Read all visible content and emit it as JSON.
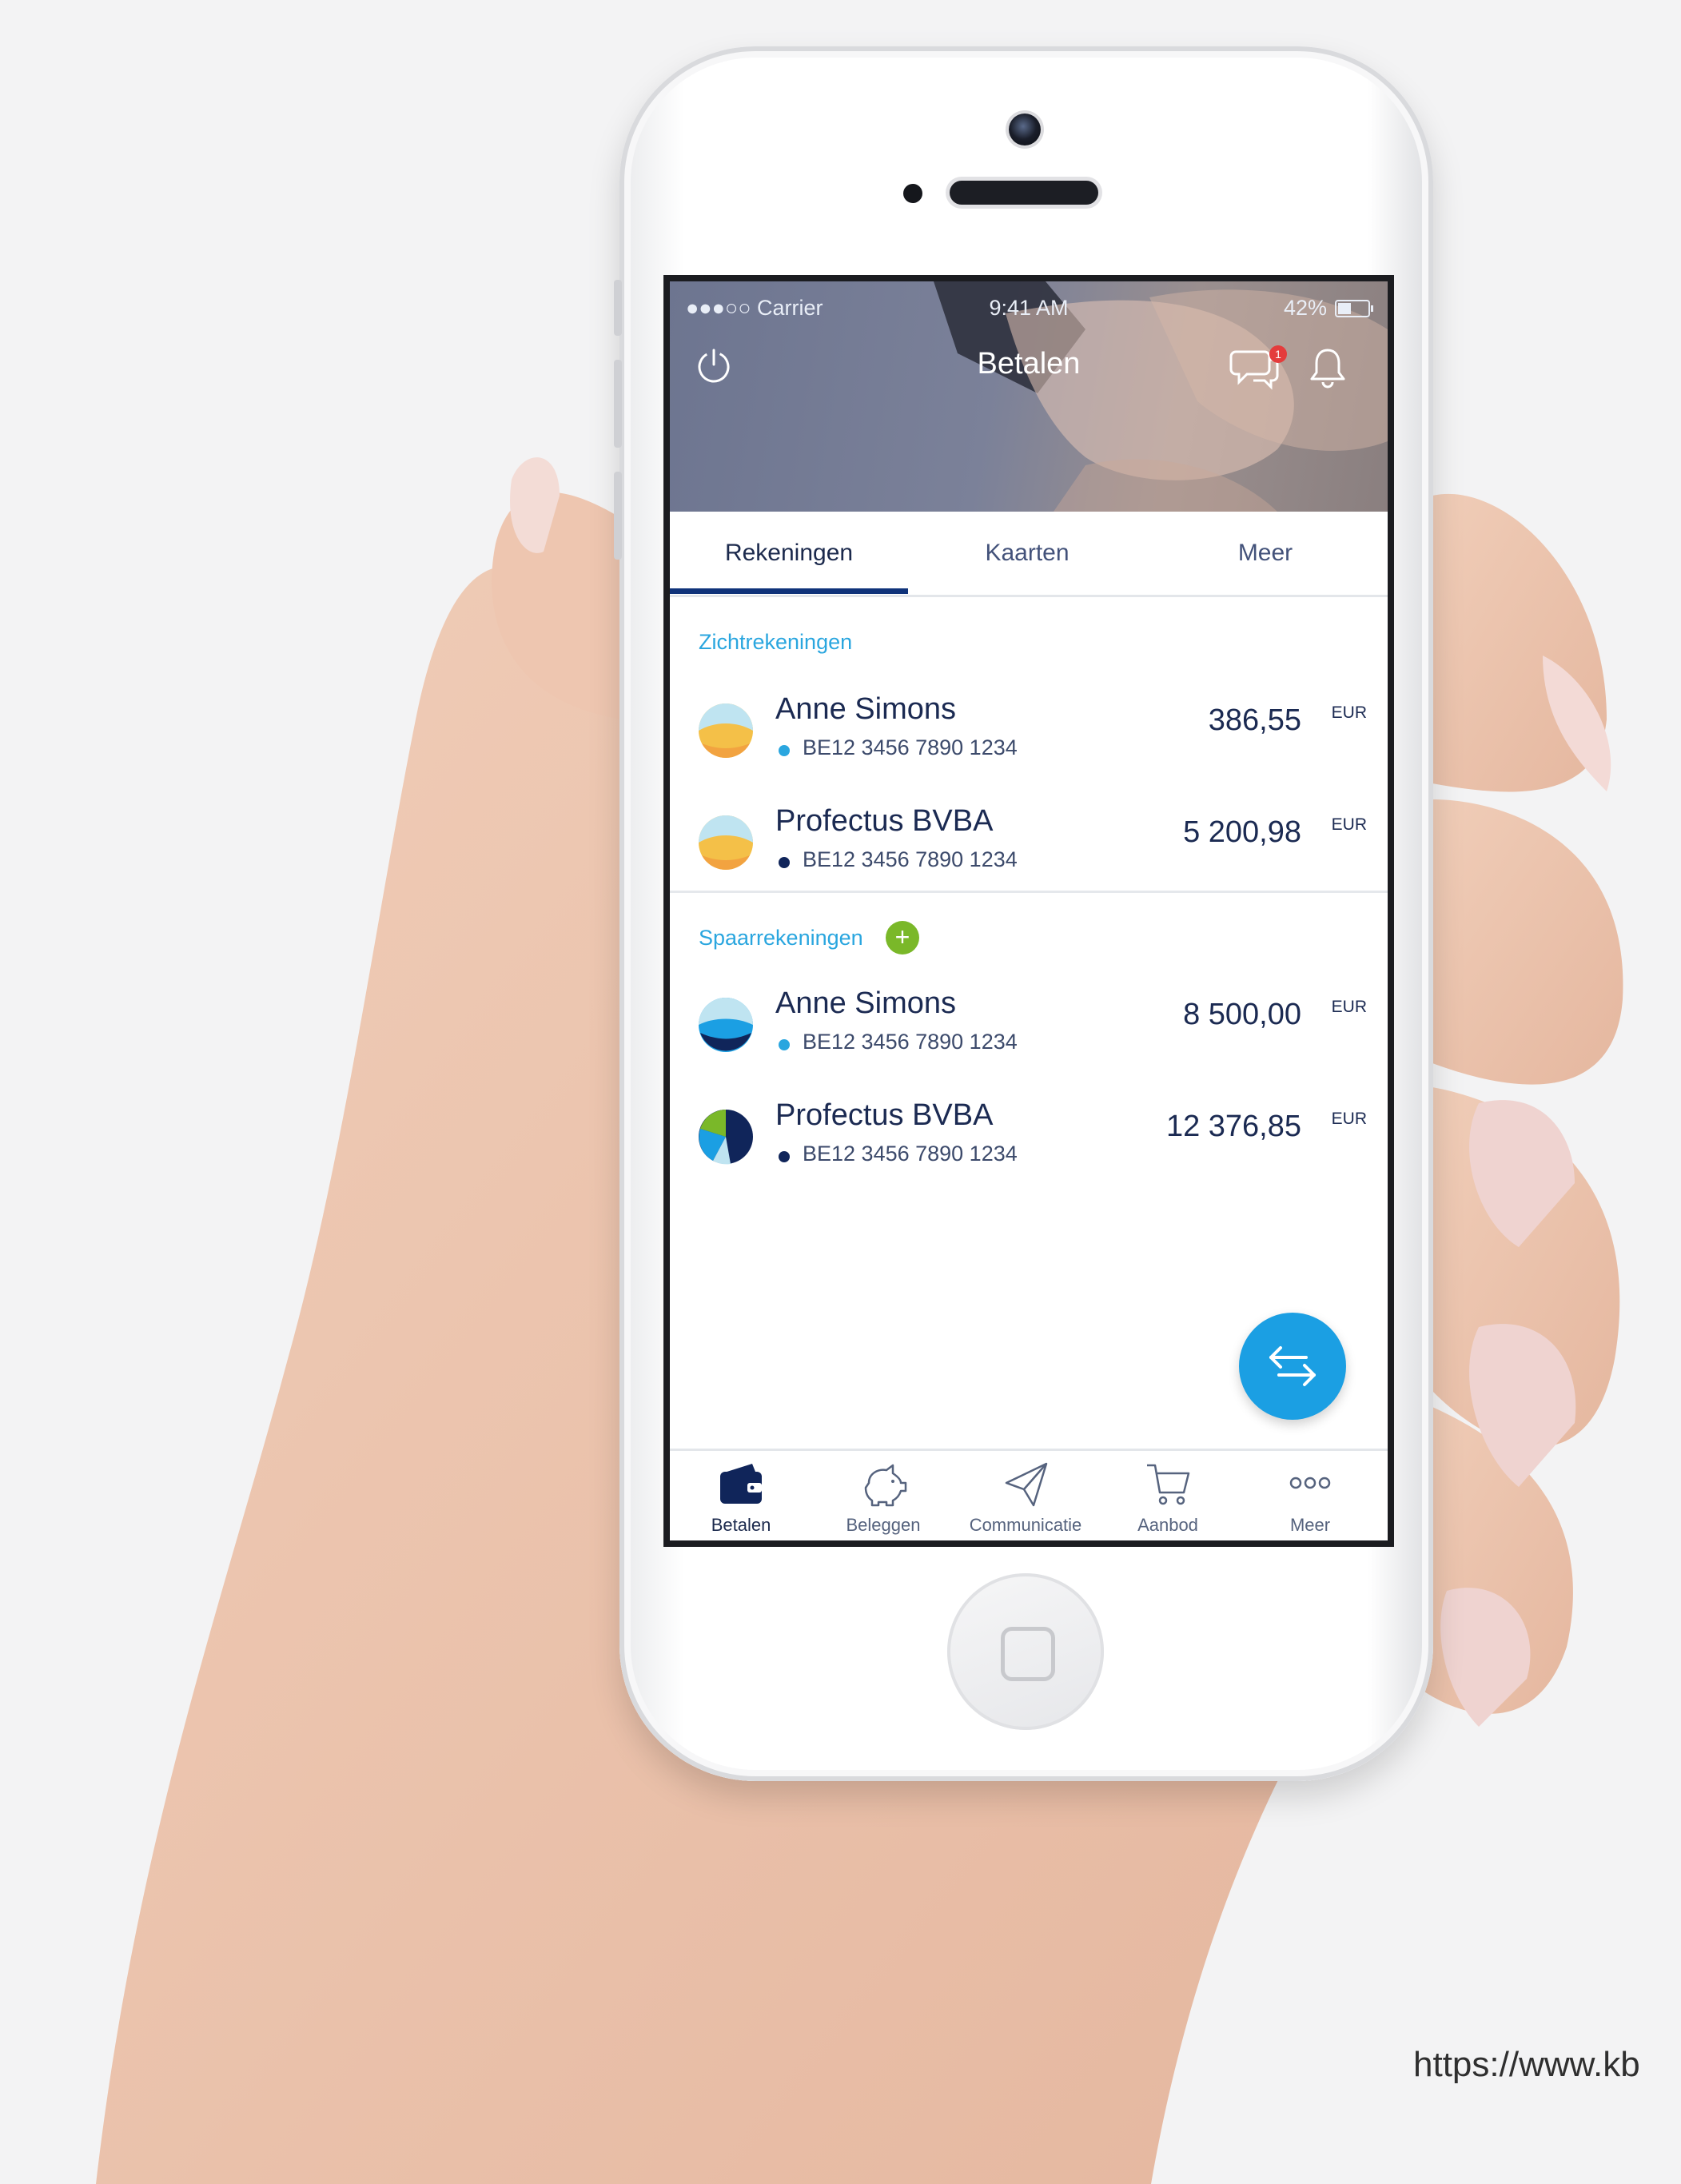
{
  "status_bar": {
    "carrier": "●●●○○ Carrier",
    "time": "9:41 AM",
    "battery": "42%"
  },
  "header": {
    "title": "Betalen",
    "notification_count": "1"
  },
  "tabs": [
    {
      "label": "Rekeningen",
      "active": true
    },
    {
      "label": "Kaarten",
      "active": false
    },
    {
      "label": "Meer",
      "active": false
    }
  ],
  "sections": [
    {
      "label": "Zichtrekeningen",
      "accounts": [
        {
          "name": "Anne Simons",
          "iban": "BE12 3456 7890 1234",
          "amount": "386,55",
          "currency": "EUR",
          "dot_color": "#2aa6df"
        },
        {
          "name": "Profectus BVBA",
          "iban": "BE12 3456 7890 1234",
          "amount": "5 200,98",
          "currency": "EUR",
          "dot_color": "#10255a"
        }
      ]
    },
    {
      "label": "Spaarrekeningen",
      "add_badge": "+",
      "accounts": [
        {
          "name": "Anne Simons",
          "iban": "BE12 3456 7890 1234",
          "amount": "8 500,00",
          "currency": "EUR",
          "dot_color": "#2aa6df"
        },
        {
          "name": "Profectus BVBA",
          "iban": "BE12 3456 7890 1234",
          "amount": "12 376,85",
          "currency": "EUR",
          "dot_color": "#10255a"
        }
      ]
    }
  ],
  "bottom_nav": [
    {
      "label": "Betalen",
      "icon": "wallet-icon",
      "active": true
    },
    {
      "label": "Beleggen",
      "icon": "piggy-bank-icon",
      "active": false
    },
    {
      "label": "Communicatie",
      "icon": "paper-plane-icon",
      "active": false
    },
    {
      "label": "Aanbod",
      "icon": "shopping-cart-icon",
      "active": false
    },
    {
      "label": "Meer",
      "icon": "more-dots-icon",
      "active": false
    }
  ],
  "url_text": "https://www.kb",
  "colors": {
    "primary": "#10337a",
    "accent": "#1b9fe3",
    "section_label": "#2aa6df",
    "add_badge": "#7ab829"
  }
}
